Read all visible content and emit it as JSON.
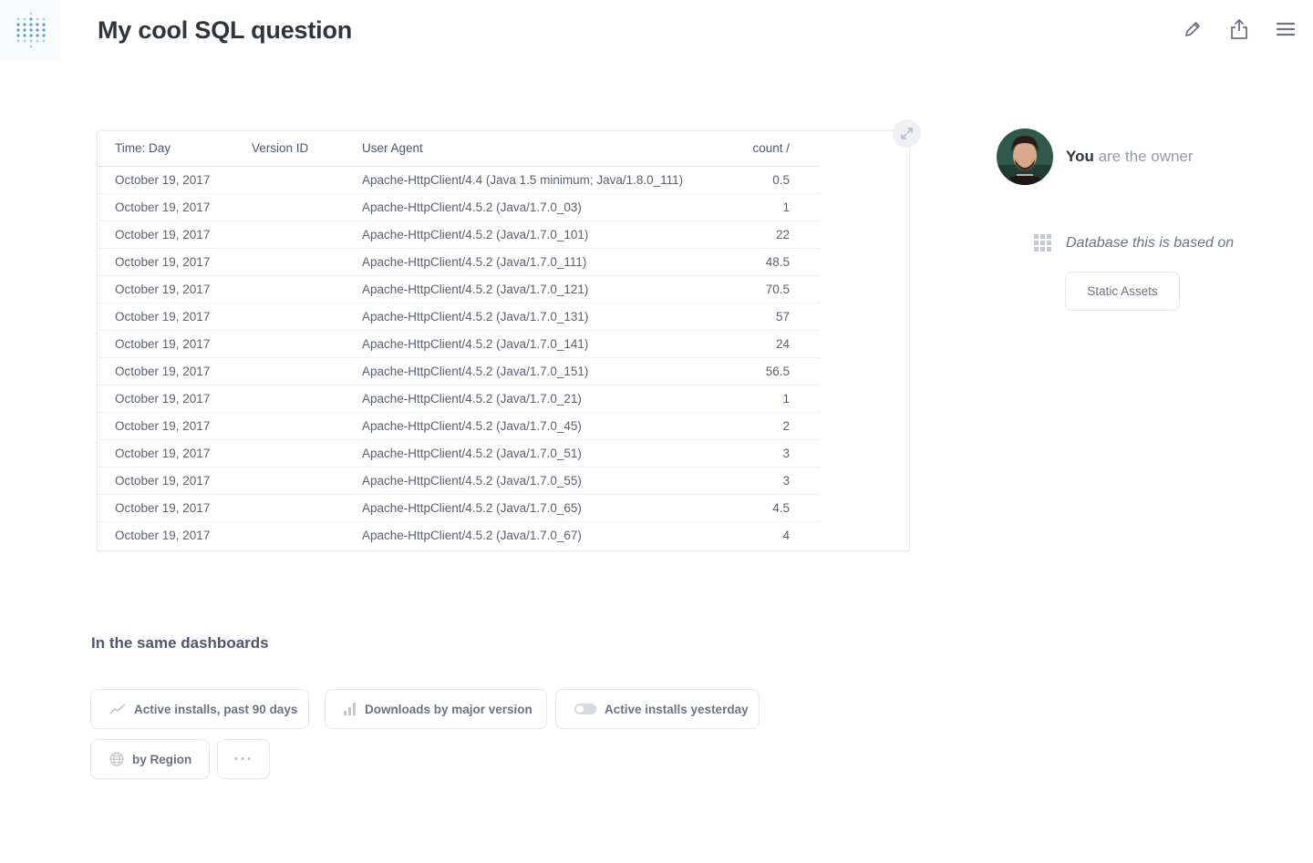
{
  "header": {
    "title": "My cool SQL question",
    "actions": [
      {
        "icon": "pencil-icon"
      },
      {
        "icon": "share-icon"
      },
      {
        "icon": "menu-icon"
      }
    ]
  },
  "table": {
    "columns": [
      "Time: Day",
      "Version ID",
      "User Agent",
      "count /"
    ],
    "rows": [
      [
        "October 19, 2017",
        "",
        "Apache-HttpClient/4.4 (Java 1.5 minimum; Java/1.8.0_111)",
        "0.5"
      ],
      [
        "October 19, 2017",
        "",
        "Apache-HttpClient/4.5.2 (Java/1.7.0_03)",
        "1"
      ],
      [
        "October 19, 2017",
        "",
        "Apache-HttpClient/4.5.2 (Java/1.7.0_101)",
        "22"
      ],
      [
        "October 19, 2017",
        "",
        "Apache-HttpClient/4.5.2 (Java/1.7.0_111)",
        "48.5"
      ],
      [
        "October 19, 2017",
        "",
        "Apache-HttpClient/4.5.2 (Java/1.7.0_121)",
        "70.5"
      ],
      [
        "October 19, 2017",
        "",
        "Apache-HttpClient/4.5.2 (Java/1.7.0_131)",
        "57"
      ],
      [
        "October 19, 2017",
        "",
        "Apache-HttpClient/4.5.2 (Java/1.7.0_141)",
        "24"
      ],
      [
        "October 19, 2017",
        "",
        "Apache-HttpClient/4.5.2 (Java/1.7.0_151)",
        "56.5"
      ],
      [
        "October 19, 2017",
        "",
        "Apache-HttpClient/4.5.2 (Java/1.7.0_21)",
        "1"
      ],
      [
        "October 19, 2017",
        "",
        "Apache-HttpClient/4.5.2 (Java/1.7.0_45)",
        "2"
      ],
      [
        "October 19, 2017",
        "",
        "Apache-HttpClient/4.5.2 (Java/1.7.0_51)",
        "3"
      ],
      [
        "October 19, 2017",
        "",
        "Apache-HttpClient/4.5.2 (Java/1.7.0_55)",
        "3"
      ],
      [
        "October 19, 2017",
        "",
        "Apache-HttpClient/4.5.2 (Java/1.7.0_65)",
        "4.5"
      ],
      [
        "October 19, 2017",
        "",
        "Apache-HttpClient/4.5.2 (Java/1.7.0_67)",
        "4"
      ]
    ]
  },
  "sidebar": {
    "owner_you": "You",
    "owner_rest": "are the owner",
    "db_label": "Database this is based on",
    "db_name": "Static Assets"
  },
  "related": {
    "title": "In the same dashboards",
    "items": [
      {
        "label": "Active installs, past 90 days",
        "icon": "line-chart-icon"
      },
      {
        "label": "Downloads by major version",
        "icon": "bar-chart-icon"
      },
      {
        "label": "Active installs yesterday",
        "icon": "toggle-icon"
      },
      {
        "label": "by Region",
        "icon": "globe-icon"
      }
    ],
    "more_label": "···"
  },
  "colors": {
    "brand": "#509ee3",
    "text_dark": "#2e353b",
    "text_muted": "#949aab",
    "border": "#e5e8ec"
  }
}
